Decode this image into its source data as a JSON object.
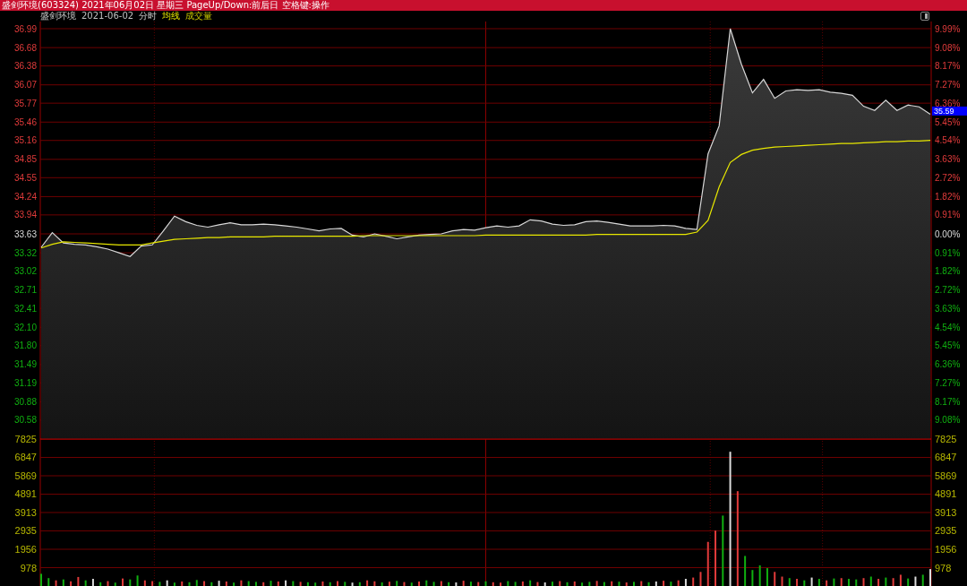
{
  "title_bar": {
    "title": "盛剑环境(603324) 2021年06月02日 星期三 PageUp/Down:前后日 空格键:操作"
  },
  "header": {
    "stock_name": "盛剑环境",
    "date": "2021-06-02"
  },
  "price_panel": {
    "last_price": "35.59",
    "right_axis": [
      {
        "label": "9.99%",
        "kind": "up"
      },
      {
        "label": "9.08%",
        "kind": "up"
      },
      {
        "label": "8.17%",
        "kind": "up"
      },
      {
        "label": "7.27%",
        "kind": "up"
      },
      {
        "label": "6.36%",
        "kind": "up"
      },
      {
        "label": "5.45%",
        "kind": "up"
      },
      {
        "label": "4.54%",
        "kind": "up"
      },
      {
        "label": "3.63%",
        "kind": "up"
      },
      {
        "label": "2.72%",
        "kind": "up"
      },
      {
        "label": "1.82%",
        "kind": "up"
      },
      {
        "label": "0.91%",
        "kind": "up"
      },
      {
        "label": "0.00%",
        "kind": "flat"
      },
      {
        "label": "0.91%",
        "kind": "down"
      },
      {
        "label": "1.82%",
        "kind": "down"
      },
      {
        "label": "2.72%",
        "kind": "down"
      },
      {
        "label": "3.63%",
        "kind": "down"
      },
      {
        "label": "4.54%",
        "kind": "down"
      },
      {
        "label": "5.45%",
        "kind": "down"
      },
      {
        "label": "6.36%",
        "kind": "down"
      },
      {
        "label": "7.27%",
        "kind": "down"
      },
      {
        "label": "8.17%",
        "kind": "down"
      },
      {
        "label": "9.08%",
        "kind": "down"
      }
    ],
    "chart_data": {
      "type": "area",
      "grid": true,
      "ylim": [
        30.27,
        36.99
      ],
      "yticks": [
        {
          "value": 36.99,
          "label": "36.99"
        },
        {
          "value": 36.68,
          "label": "36.68"
        },
        {
          "value": 36.38,
          "label": "36.38"
        },
        {
          "value": 36.07,
          "label": "36.07"
        },
        {
          "value": 35.77,
          "label": "35.77"
        },
        {
          "value": 35.46,
          "label": "35.46"
        },
        {
          "value": 35.16,
          "label": "35.16"
        },
        {
          "value": 34.85,
          "label": "34.85"
        },
        {
          "value": 34.55,
          "label": "34.55"
        },
        {
          "value": 34.24,
          "label": "34.24"
        },
        {
          "value": 33.94,
          "label": "33.94"
        },
        {
          "value": 33.63,
          "label": "33.63"
        },
        {
          "value": 33.32,
          "label": "33.32"
        },
        {
          "value": 33.02,
          "label": "33.02"
        },
        {
          "value": 32.71,
          "label": "32.71"
        },
        {
          "value": 32.41,
          "label": "32.41"
        },
        {
          "value": 32.1,
          "label": "32.10"
        },
        {
          "value": 31.8,
          "label": "31.80"
        },
        {
          "value": 31.49,
          "label": "31.49"
        },
        {
          "value": 31.19,
          "label": "31.19"
        },
        {
          "value": 30.88,
          "label": "30.88"
        },
        {
          "value": 30.58,
          "label": "30.58"
        }
      ],
      "categories": [
        null,
        null,
        null,
        null,
        null,
        null,
        null,
        null,
        null,
        null,
        null,
        null,
        null,
        null,
        null,
        null,
        null,
        null,
        null,
        null,
        null,
        null,
        null,
        null,
        null,
        null,
        null,
        null,
        null,
        null,
        null,
        null,
        null,
        null,
        null,
        null,
        null,
        null,
        null,
        null,
        null,
        null,
        null,
        null,
        null,
        null,
        null,
        null,
        null,
        null,
        null,
        null,
        null,
        null,
        null,
        null,
        null,
        null,
        null,
        null,
        null,
        null,
        null,
        null,
        null,
        null,
        null,
        null,
        null,
        null,
        null,
        null,
        null,
        null,
        null,
        null,
        null,
        null,
        null,
        null,
        null
      ],
      "series": [
        {
          "name": "分时",
          "color": "#d8d8d8",
          "values": [
            33.41,
            33.65,
            33.48,
            33.46,
            33.45,
            33.42,
            33.38,
            33.32,
            33.26,
            33.43,
            33.45,
            33.68,
            33.92,
            33.83,
            33.77,
            33.74,
            33.78,
            33.81,
            33.78,
            33.78,
            33.79,
            33.78,
            33.76,
            33.74,
            33.71,
            33.68,
            33.71,
            33.72,
            33.61,
            33.58,
            33.63,
            33.59,
            33.55,
            33.58,
            33.61,
            33.62,
            33.63,
            33.68,
            33.7,
            33.69,
            33.73,
            33.76,
            33.74,
            33.76,
            33.86,
            33.84,
            33.79,
            33.77,
            33.78,
            33.83,
            33.84,
            33.82,
            33.79,
            33.76,
            33.76,
            33.76,
            33.77,
            33.76,
            33.72,
            33.7,
            34.94,
            35.4,
            36.99,
            36.41,
            35.94,
            36.16,
            35.85,
            35.97,
            35.99,
            35.98,
            35.99,
            35.95,
            35.93,
            35.9,
            35.72,
            35.65,
            35.82,
            35.65,
            35.74,
            35.71,
            35.59
          ]
        },
        {
          "name": "均线",
          "type": "line",
          "color": "#e8e800",
          "values": [
            33.4,
            33.46,
            33.5,
            33.49,
            33.48,
            33.47,
            33.46,
            33.45,
            33.45,
            33.45,
            33.48,
            33.51,
            33.54,
            33.55,
            33.56,
            33.57,
            33.57,
            33.58,
            33.58,
            33.58,
            33.58,
            33.59,
            33.59,
            33.59,
            33.59,
            33.59,
            33.59,
            33.59,
            33.59,
            33.6,
            33.6,
            33.6,
            33.6,
            33.6,
            33.6,
            33.6,
            33.6,
            33.6,
            33.6,
            33.6,
            33.61,
            33.61,
            33.61,
            33.61,
            33.61,
            33.61,
            33.61,
            33.61,
            33.61,
            33.61,
            33.62,
            33.62,
            33.62,
            33.62,
            33.62,
            33.62,
            33.62,
            33.62,
            33.62,
            33.66,
            33.85,
            34.4,
            34.8,
            34.93,
            35.0,
            35.03,
            35.05,
            35.06,
            35.07,
            35.08,
            35.09,
            35.1,
            35.11,
            35.11,
            35.12,
            35.13,
            35.14,
            35.14,
            35.15,
            35.15,
            35.16
          ]
        }
      ]
    }
  },
  "volume_panel": {
    "right_axis": [
      "7825",
      "6847",
      "5869",
      "4891",
      "3913",
      "2935",
      "1956",
      "978"
    ],
    "bars": [
      {
        "kind": "down"
      },
      {
        "kind": "down"
      },
      {
        "kind": "up"
      },
      {
        "kind": "down"
      },
      {
        "kind": "up"
      },
      {
        "kind": "up"
      },
      {
        "kind": "down"
      },
      {
        "kind": "flat"
      },
      {
        "kind": "down"
      },
      {
        "kind": "up"
      },
      {
        "kind": "down"
      },
      {
        "kind": "up"
      },
      {
        "kind": "down"
      },
      {
        "kind": "down"
      },
      {
        "kind": "up"
      },
      {
        "kind": "up"
      },
      {
        "kind": "down"
      },
      {
        "kind": "flat"
      },
      {
        "kind": "down"
      },
      {
        "kind": "up"
      },
      {
        "kind": "down"
      },
      {
        "kind": "down"
      },
      {
        "kind": "up"
      },
      {
        "kind": "down"
      },
      {
        "kind": "flat"
      },
      {
        "kind": "up"
      },
      {
        "kind": "down"
      },
      {
        "kind": "up"
      },
      {
        "kind": "down"
      },
      {
        "kind": "down"
      },
      {
        "kind": "up"
      },
      {
        "kind": "down"
      },
      {
        "kind": "up"
      },
      {
        "kind": "flat"
      },
      {
        "kind": "down"
      },
      {
        "kind": "up"
      },
      {
        "kind": "down"
      },
      {
        "kind": "down"
      },
      {
        "kind": "up"
      },
      {
        "kind": "down"
      },
      {
        "kind": "up"
      },
      {
        "kind": "down"
      },
      {
        "kind": "flat"
      },
      {
        "kind": "down"
      },
      {
        "kind": "up"
      },
      {
        "kind": "up"
      },
      {
        "kind": "down"
      },
      {
        "kind": "up"
      },
      {
        "kind": "down"
      },
      {
        "kind": "up"
      },
      {
        "kind": "down"
      },
      {
        "kind": "up"
      },
      {
        "kind": "down"
      },
      {
        "kind": "down"
      },
      {
        "kind": "up"
      },
      {
        "kind": "down"
      },
      {
        "kind": "flat"
      },
      {
        "kind": "up"
      },
      {
        "kind": "down"
      },
      {
        "kind": "up"
      },
      {
        "kind": "down"
      },
      {
        "kind": "up"
      },
      {
        "kind": "up"
      },
      {
        "kind": "down"
      },
      {
        "kind": "down"
      },
      {
        "kind": "up"
      },
      {
        "kind": "down"
      },
      {
        "kind": "up"
      },
      {
        "kind": "flat"
      },
      {
        "kind": "down"
      },
      {
        "kind": "up"
      },
      {
        "kind": "down"
      },
      {
        "kind": "up"
      },
      {
        "kind": "down"
      },
      {
        "kind": "down"
      },
      {
        "kind": "up"
      },
      {
        "kind": "down"
      },
      {
        "kind": "up"
      },
      {
        "kind": "down"
      },
      {
        "kind": "up"
      },
      {
        "kind": "down"
      },
      {
        "kind": "up"
      },
      {
        "kind": "down"
      },
      {
        "kind": "flat"
      },
      {
        "kind": "up"
      },
      {
        "kind": "down"
      },
      {
        "kind": "up"
      },
      {
        "kind": "flat"
      },
      {
        "kind": "up"
      },
      {
        "kind": "up"
      },
      {
        "kind": "up"
      },
      {
        "kind": "up"
      },
      {
        "kind": "down"
      },
      {
        "kind": "flat"
      },
      {
        "kind": "up"
      },
      {
        "kind": "down"
      },
      {
        "kind": "down"
      },
      {
        "kind": "down"
      },
      {
        "kind": "down"
      },
      {
        "kind": "up"
      },
      {
        "kind": "up"
      },
      {
        "kind": "down"
      },
      {
        "kind": "up"
      },
      {
        "kind": "down"
      },
      {
        "kind": "flat"
      },
      {
        "kind": "down"
      },
      {
        "kind": "up"
      },
      {
        "kind": "down"
      },
      {
        "kind": "up"
      },
      {
        "kind": "down"
      },
      {
        "kind": "down"
      },
      {
        "kind": "up"
      },
      {
        "kind": "down"
      },
      {
        "kind": "up"
      },
      {
        "kind": "down"
      },
      {
        "kind": "up"
      },
      {
        "kind": "up"
      },
      {
        "kind": "down"
      },
      {
        "kind": "flat"
      },
      {
        "kind": "down"
      },
      {
        "kind": "flat"
      }
    ],
    "chart_data": {
      "type": "bar",
      "grid": true,
      "ylim": [
        0,
        7825
      ],
      "yticks": [
        {
          "value": 978,
          "label": "978"
        },
        {
          "value": 1956,
          "label": "1956"
        },
        {
          "value": 2935,
          "label": "2935"
        },
        {
          "value": 3913,
          "label": "3913"
        },
        {
          "value": 4891,
          "label": "4891"
        },
        {
          "value": 5869,
          "label": "5869"
        },
        {
          "value": 6847,
          "label": "6847"
        },
        {
          "value": 7825,
          "label": "7825"
        }
      ],
      "categories": [
        null,
        null,
        null,
        null,
        null,
        null,
        null,
        null,
        null,
        null,
        null,
        null,
        null,
        null,
        null,
        null,
        null,
        null,
        null,
        null,
        null,
        null,
        null,
        null,
        null,
        null,
        null,
        null,
        null,
        null,
        null,
        null,
        null,
        null,
        null,
        null,
        null,
        null,
        null,
        null,
        null,
        null,
        null,
        null,
        null,
        null,
        null,
        null,
        null,
        null,
        null,
        null,
        null,
        null,
        null,
        null,
        null,
        null,
        null,
        null,
        null,
        null,
        null,
        null,
        null,
        null,
        null,
        null,
        null,
        null,
        null,
        null,
        null,
        null,
        null,
        null,
        null,
        null,
        null,
        null,
        null,
        null,
        null,
        null,
        null,
        null,
        null,
        null,
        null,
        null,
        null,
        null,
        null,
        null,
        null,
        null,
        null,
        null,
        null,
        null,
        null,
        null,
        null,
        null,
        null,
        null,
        null,
        null,
        null,
        null,
        null,
        null,
        null,
        null,
        null,
        null,
        null,
        null,
        null,
        null,
        null
      ],
      "series": [
        {
          "name": "成交量",
          "values": [
            650,
            420,
            300,
            350,
            250,
            480,
            300,
            380,
            200,
            260,
            180,
            400,
            350,
            560,
            300,
            260,
            220,
            300,
            180,
            240,
            200,
            320,
            260,
            200,
            280,
            240,
            180,
            300,
            260,
            220,
            200,
            280,
            240,
            300,
            260,
            220,
            200,
            180,
            240,
            200,
            260,
            220,
            180,
            200,
            300,
            250,
            190,
            230,
            270,
            210,
            180,
            240,
            300,
            220,
            260,
            200,
            190,
            280,
            230,
            210,
            250,
            200,
            180,
            260,
            220,
            240,
            300,
            210,
            190,
            230,
            260,
            200,
            240,
            180,
            220,
            270,
            210,
            250,
            230,
            190,
            220,
            260,
            200,
            240,
            280,
            230,
            300,
            380,
            450,
            750,
            2350,
            2950,
            3750,
            7150,
            5050,
            1600,
            850,
            1100,
            950,
            750,
            500,
            420,
            380,
            300,
            450,
            380,
            300,
            400,
            420,
            380,
            350,
            420,
            500,
            380,
            450,
            420,
            600,
            400,
            500,
            600,
            900
          ]
        }
      ]
    }
  }
}
